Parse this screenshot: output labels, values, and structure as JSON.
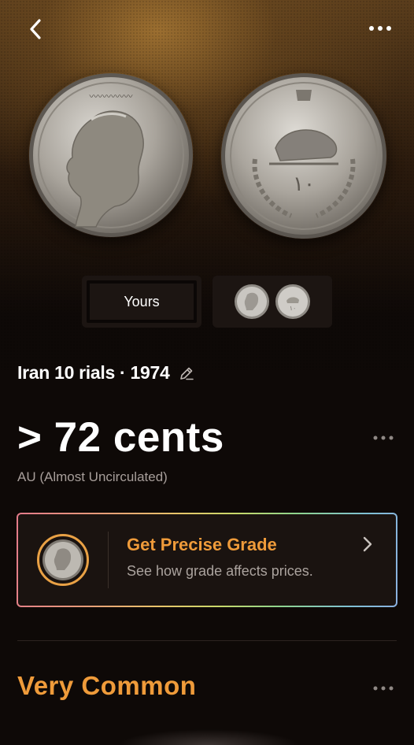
{
  "toolbar": {
    "back_icon": "chevron-left-icon",
    "more_icon": "ellipsis-icon"
  },
  "images": {
    "obverse": "coin-obverse-portrait",
    "reverse": "coin-reverse-lion-and-sun"
  },
  "photo_toggle": {
    "yours_label": "Yours"
  },
  "coin": {
    "title": "Iran 10 rials · 1974"
  },
  "valuation": {
    "price": "> 72 cents",
    "grade": "AU (Almost Uncirculated)"
  },
  "grade_card": {
    "title": "Get Precise Grade",
    "subtitle": "See how grade affects prices."
  },
  "rarity": {
    "label": "Very Common"
  },
  "colors": {
    "accent": "#ef9b3a",
    "background": "#0e0907"
  }
}
